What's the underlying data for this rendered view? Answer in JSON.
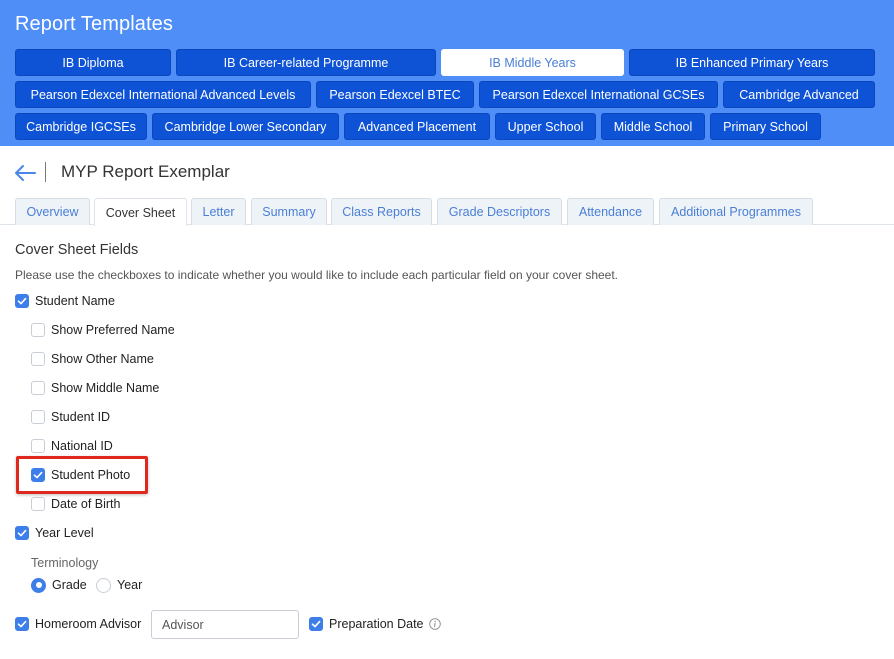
{
  "banner": {
    "title": "Report Templates",
    "templates": [
      "IB Diploma",
      "IB Career-related Programme",
      "IB Middle Years",
      "IB Enhanced Primary Years",
      "Pearson Edexcel International Advanced Levels",
      "Pearson Edexcel BTEC",
      "Pearson Edexcel International GCSEs",
      "Cambridge Advanced",
      "Cambridge IGCSEs",
      "Cambridge Lower Secondary",
      "Advanced Placement",
      "Upper School",
      "Middle School",
      "Primary School"
    ],
    "active_template": "IB Middle Years"
  },
  "header": {
    "title": "MYP Report Exemplar",
    "back_icon": "arrow-left-icon"
  },
  "tabs": [
    "Overview",
    "Cover Sheet",
    "Letter",
    "Summary",
    "Class Reports",
    "Grade Descriptors",
    "Attendance",
    "Additional Programmes"
  ],
  "active_tab": "Cover Sheet",
  "cover_sheet": {
    "section_title": "Cover Sheet Fields",
    "help_text": "Please use the checkboxes to indicate whether you would like to include each particular field on your cover sheet.",
    "student_name": {
      "label": "Student Name",
      "checked": true
    },
    "sub_fields": [
      {
        "label": "Show Preferred Name",
        "checked": false
      },
      {
        "label": "Show Other Name",
        "checked": false
      },
      {
        "label": "Show Middle Name",
        "checked": false
      },
      {
        "label": "Student ID",
        "checked": false
      },
      {
        "label": "National ID",
        "checked": false
      },
      {
        "label": "Student Photo",
        "checked": true,
        "highlighted": true
      },
      {
        "label": "Date of Birth",
        "checked": false
      }
    ],
    "year_level": {
      "label": "Year Level",
      "checked": true
    },
    "terminology": {
      "label": "Terminology",
      "options": [
        {
          "label": "Grade",
          "selected": true
        },
        {
          "label": "Year",
          "selected": false
        }
      ]
    },
    "homeroom_advisor": {
      "label": "Homeroom Advisor",
      "checked": true,
      "input_value": "Advisor"
    },
    "preparation_date": {
      "label": "Preparation Date",
      "checked": true,
      "info_icon": "info-icon"
    }
  },
  "colors": {
    "banner": "#4f8ef7",
    "template_button": "#0e53d6",
    "accent": "#3d7ee8",
    "highlight": "#e0291e"
  }
}
